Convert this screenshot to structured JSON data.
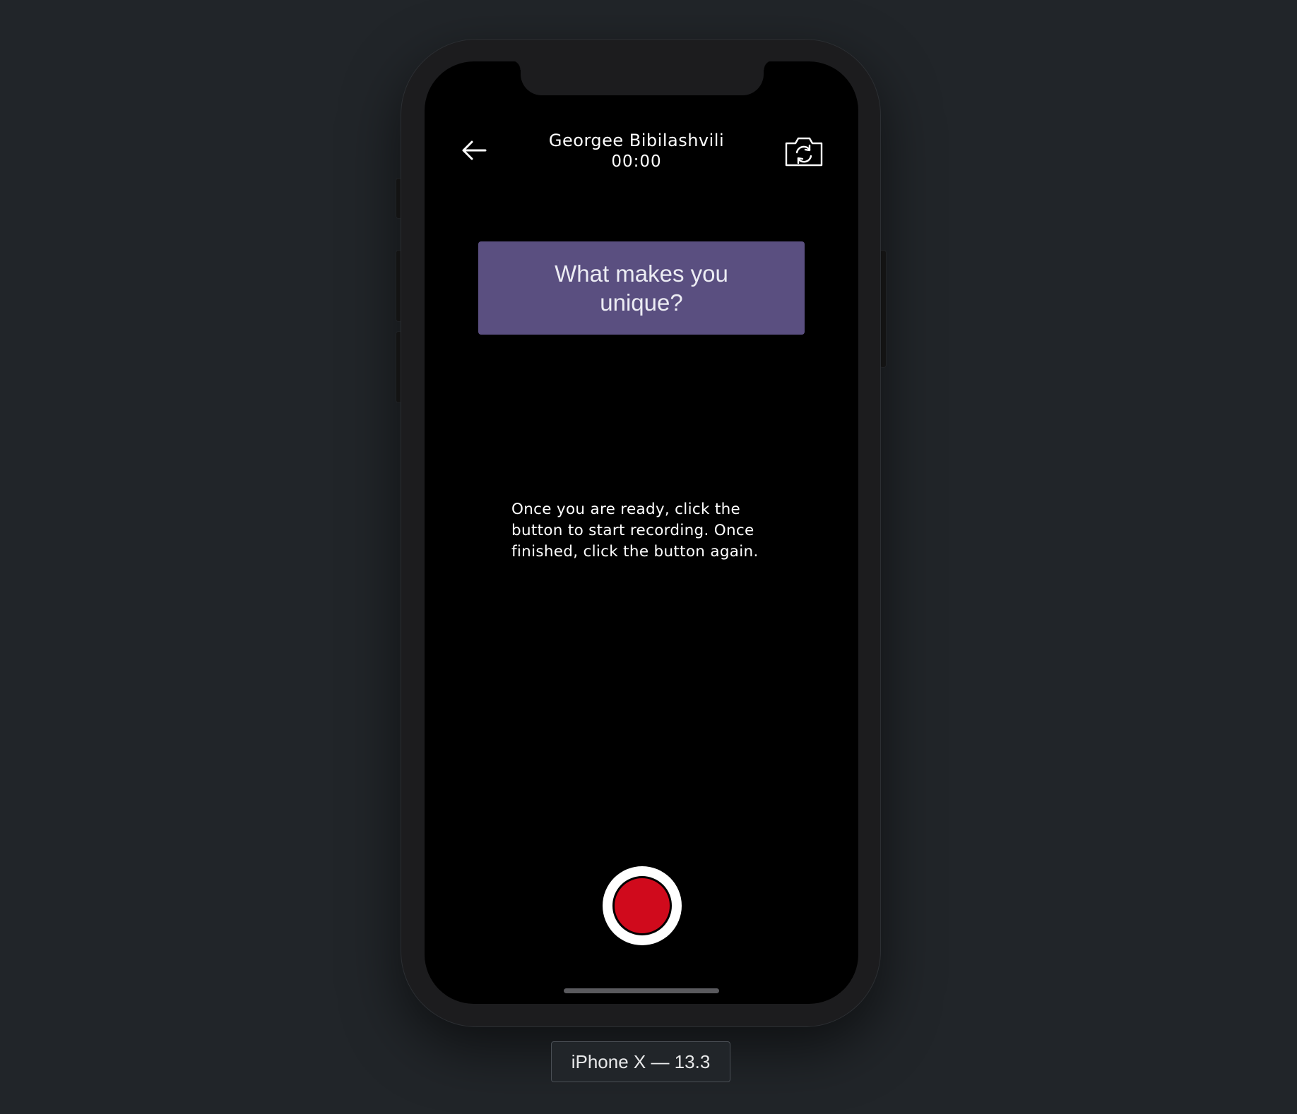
{
  "header": {
    "participant_name": "Georgee Bibilashvili",
    "timer": "00:00",
    "back_icon": "arrow-left-icon",
    "camera_icon": "camera-switch-icon"
  },
  "question": {
    "text": "What makes you unique?"
  },
  "instructions": {
    "text": "Once you are ready, click the button to start recording. Once finished, click the button again."
  },
  "record_button": {
    "icon": "record-icon",
    "color": "#d00a1c"
  },
  "device": {
    "label": "iPhone X — 13.3"
  },
  "colors": {
    "background": "#212529",
    "screen": "#000000",
    "question_card": "#5a4f80",
    "record": "#d00a1c"
  }
}
